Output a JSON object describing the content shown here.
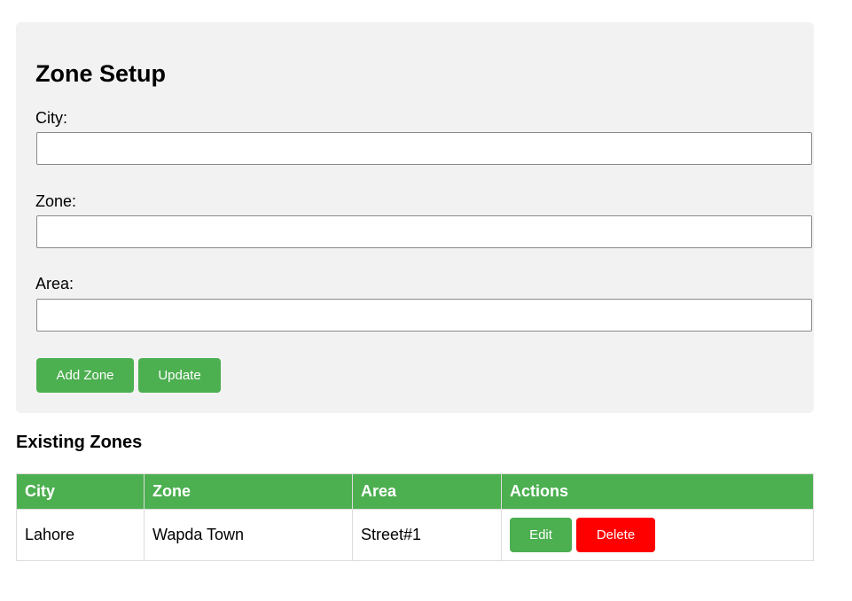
{
  "form": {
    "title": "Zone Setup",
    "city_label": "City:",
    "city_value": "",
    "zone_label": "Zone:",
    "zone_value": "",
    "area_label": "Area:",
    "area_value": "",
    "add_button": "Add Zone",
    "update_button": "Update"
  },
  "zones": {
    "title": "Existing Zones",
    "columns": [
      "City",
      "Zone",
      "Area",
      "Actions"
    ],
    "rows": [
      {
        "city": "Lahore",
        "zone": "Wapda Town",
        "area": "Street#1",
        "edit_label": "Edit",
        "delete_label": "Delete"
      }
    ]
  },
  "colors": {
    "accent": "#4caf50",
    "danger": "#ff0000",
    "panel_bg": "#f2f2f2"
  }
}
